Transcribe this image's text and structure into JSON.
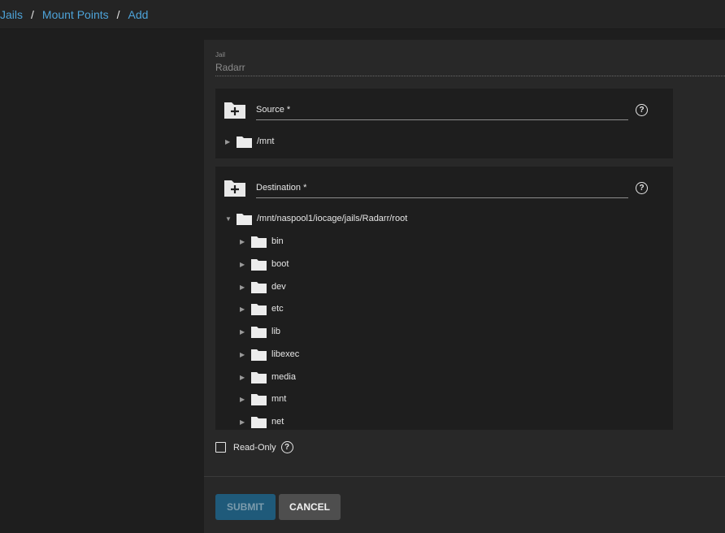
{
  "breadcrumb": {
    "items": [
      "Jails",
      "Mount Points",
      "Add"
    ],
    "separator": "/"
  },
  "jail": {
    "label": "Jail",
    "value": "Radarr"
  },
  "source": {
    "label": "Source *",
    "tree": [
      {
        "name": "/mnt",
        "expanded": false
      }
    ]
  },
  "destination": {
    "label": "Destination *",
    "root": {
      "name": "/mnt/naspool1/iocage/jails/Radarr/root",
      "expanded": true
    },
    "children": [
      "bin",
      "boot",
      "dev",
      "etc",
      "lib",
      "libexec",
      "media",
      "mnt",
      "net"
    ]
  },
  "read_only": {
    "label": "Read-Only",
    "checked": false
  },
  "actions": {
    "submit": "SUBMIT",
    "cancel": "CANCEL"
  },
  "colors": {
    "accent": "#4da3d9",
    "submit_bg": "#1f5a7a",
    "cancel_bg": "#4e4e4e"
  },
  "icons": [
    "folder-add-icon",
    "help-icon",
    "folder-icon",
    "expand-arrow-icon"
  ]
}
